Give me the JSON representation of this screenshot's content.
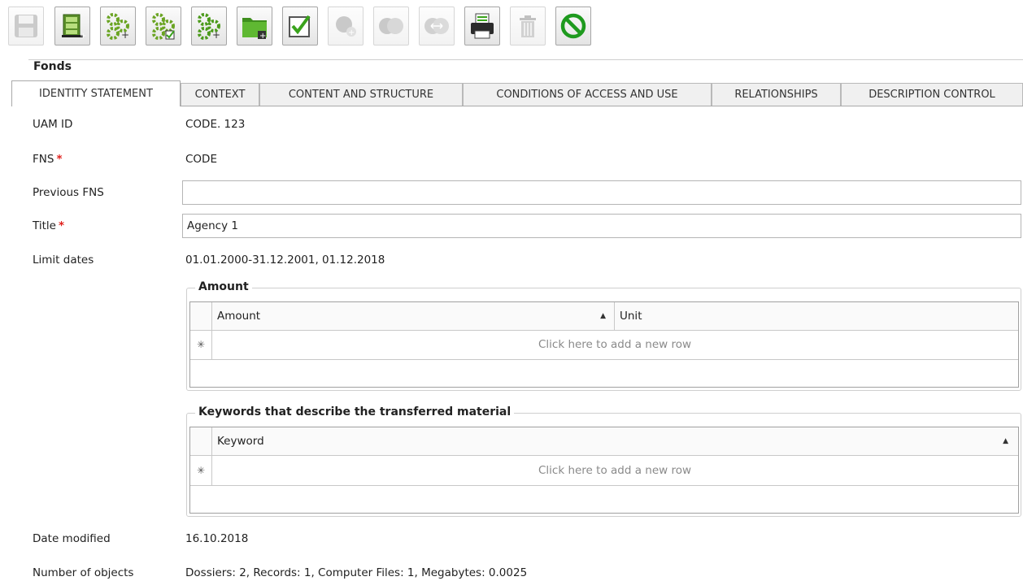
{
  "toolbar": {
    "buttons": [
      {
        "name": "save-button",
        "icon": "floppy-disk-icon",
        "enabled": false
      },
      {
        "name": "cabinet-add-button",
        "icon": "filing-cabinet-add-icon",
        "enabled": true
      },
      {
        "name": "gears-add-button",
        "icon": "gears-add-icon",
        "enabled": true
      },
      {
        "name": "gears-check-button",
        "icon": "gears-check-icon",
        "enabled": true
      },
      {
        "name": "gears-add-green-button",
        "icon": "gears-add-green-icon",
        "enabled": true
      },
      {
        "name": "folder-add-button",
        "icon": "green-folder-add-icon",
        "enabled": true
      },
      {
        "name": "checkbox-button",
        "icon": "check-box-icon",
        "enabled": true
      },
      {
        "name": "circle-add-button",
        "icon": "circle-add-icon",
        "enabled": false
      },
      {
        "name": "merge-button",
        "icon": "merge-circles-icon",
        "enabled": false
      },
      {
        "name": "link-button",
        "icon": "link-arrows-icon",
        "enabled": false
      },
      {
        "name": "print-button",
        "icon": "printer-icon",
        "enabled": true
      },
      {
        "name": "delete-button",
        "icon": "trash-can-icon",
        "enabled": false
      },
      {
        "name": "cancel-button",
        "icon": "no-entry-icon",
        "enabled": true
      }
    ]
  },
  "group_title": "Fonds",
  "tabs": [
    {
      "label": "IDENTITY STATEMENT",
      "active": true
    },
    {
      "label": "CONTEXT",
      "active": false
    },
    {
      "label": "CONTENT AND STRUCTURE",
      "active": false
    },
    {
      "label": "CONDITIONS OF ACCESS AND USE",
      "active": false
    },
    {
      "label": "RELATIONSHIPS",
      "active": false
    },
    {
      "label": "DESCRIPTION CONTROL",
      "active": false
    }
  ],
  "form": {
    "uam_id": {
      "label": "UAM ID",
      "value": "CODE. 123"
    },
    "fns": {
      "label": "FNS",
      "required_mark": "*",
      "value": "CODE"
    },
    "previous_fns": {
      "label": "Previous FNS",
      "value": ""
    },
    "title": {
      "label": "Title",
      "required_mark": "*",
      "value": "Agency 1"
    },
    "limit_dates": {
      "label": "Limit dates",
      "value": "01.01.2000-31.12.2001, 01.12.2018"
    },
    "date_modified": {
      "label": "Date modified",
      "value": "16.10.2018"
    },
    "number_of_objects": {
      "label": "Number of objects",
      "value": "Dossiers: 2, Records: 1, Computer Files: 1, Megabytes: 0.0025"
    }
  },
  "amount_group": {
    "title": "Amount",
    "columns": [
      "Amount",
      "Unit"
    ],
    "new_row_indicator": "✳",
    "new_row_text": "Click here to add a new row",
    "sort_glyph": "▲"
  },
  "keywords_group": {
    "title": "Keywords that describe the transferred material",
    "columns": [
      "Keyword"
    ],
    "new_row_indicator": "✳",
    "new_row_text": "Click here to add a new row",
    "sort_glyph": "▲"
  },
  "colors": {
    "green_icon": "#3aa31c",
    "required": "#e0201c",
    "border": "#b5b5b5"
  }
}
